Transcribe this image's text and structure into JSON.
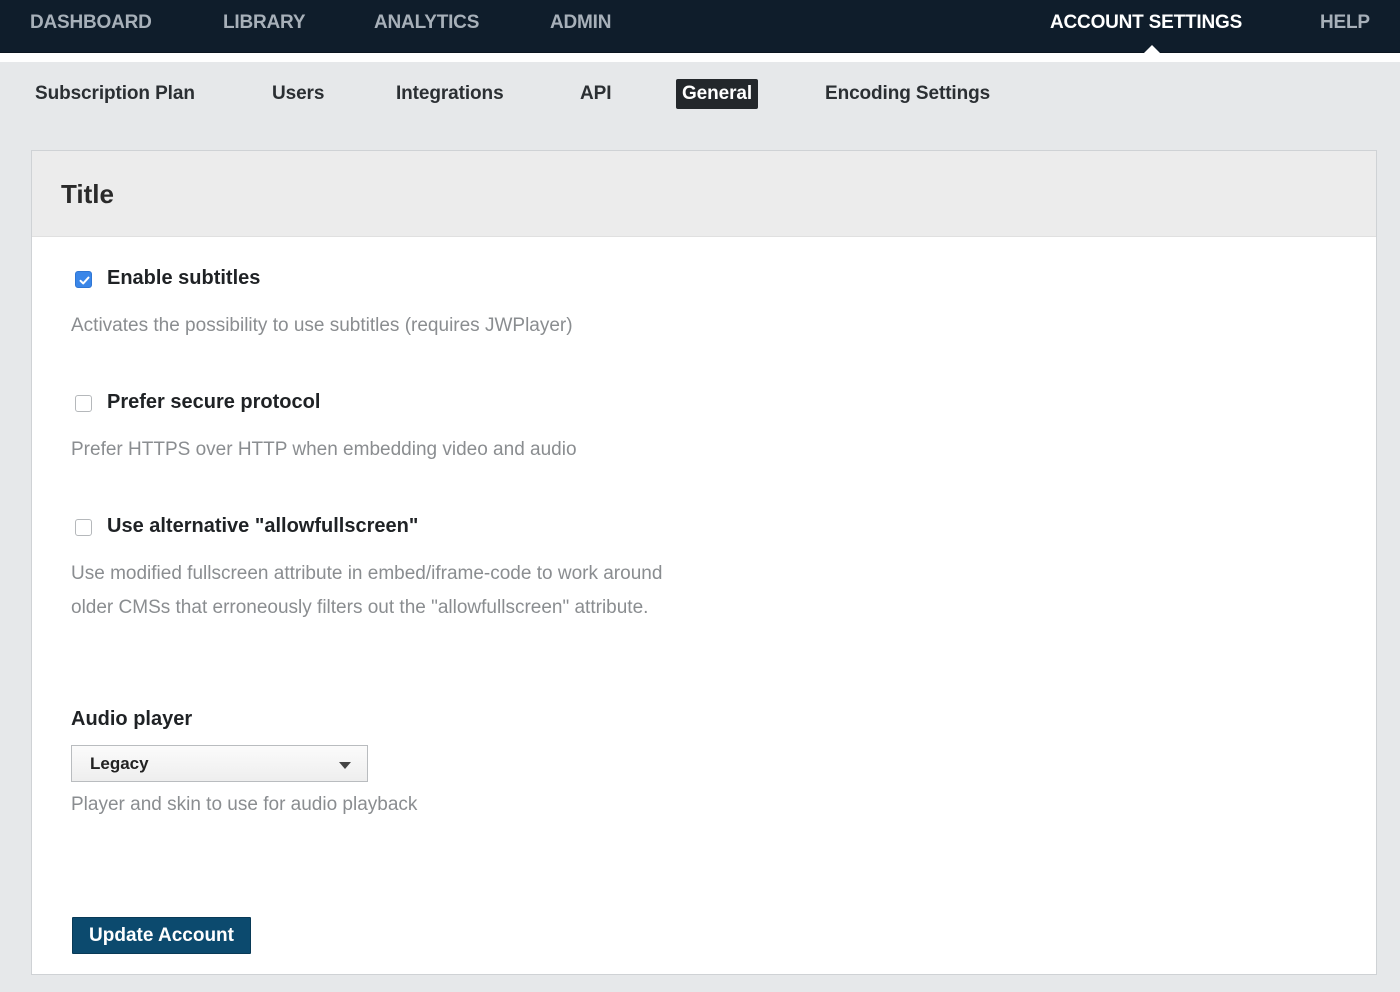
{
  "topnav": {
    "items": [
      {
        "label": "DASHBOARD"
      },
      {
        "label": "LIBRARY"
      },
      {
        "label": "ANALYTICS"
      },
      {
        "label": "ADMIN"
      },
      {
        "label": "ACCOUNT SETTINGS",
        "active": true
      },
      {
        "label": "HELP"
      }
    ]
  },
  "subtabs": {
    "items": [
      {
        "label": "Subscription Plan"
      },
      {
        "label": "Users"
      },
      {
        "label": "Integrations"
      },
      {
        "label": "API"
      },
      {
        "label": "General",
        "active": true
      },
      {
        "label": "Encoding Settings"
      }
    ]
  },
  "panel": {
    "title": "Title",
    "options": [
      {
        "label": "Enable subtitles",
        "checked": true,
        "help": "Activates the possibility to use subtitles (requires JWPlayer)"
      },
      {
        "label": "Prefer secure protocol",
        "checked": false,
        "help": "Prefer HTTPS over HTTP when embedding video and audio"
      },
      {
        "label": "Use alternative \"allowfullscreen\"",
        "checked": false,
        "help": "Use modified fullscreen attribute in embed/iframe-code to work around older CMSs that erroneously filters out the \"allowfullscreen\" attribute."
      }
    ],
    "audio_player": {
      "label": "Audio player",
      "selected": "Legacy",
      "help": "Player and skin to use for audio playback"
    },
    "submit_label": "Update Account"
  },
  "colors": {
    "nav_background": "#0f1d2b",
    "checkbox_checked": "#3a86e8",
    "button_background": "#0c4a6e"
  }
}
